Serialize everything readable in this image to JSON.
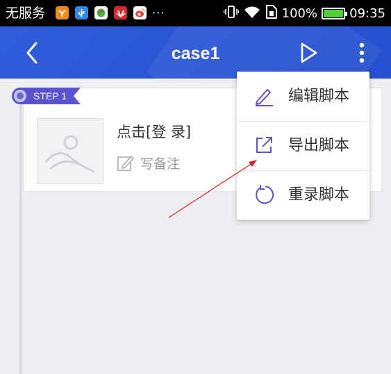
{
  "status_bar": {
    "carrier": "无服务",
    "more": "···",
    "battery_text": "100%",
    "time": "09:35",
    "battery_level": 1.0,
    "app_icons": [
      {
        "name": "game-app-icon",
        "color": "#f28a1c"
      },
      {
        "name": "usb-icon",
        "color": "#2d8ae6"
      },
      {
        "name": "browser-app-icon",
        "color": "#3fb64a"
      },
      {
        "name": "huawei-app-icon",
        "color": "#d8262e"
      },
      {
        "name": "weibo-app-icon",
        "color": "#f0a020"
      }
    ]
  },
  "app_bar": {
    "title": "case1",
    "back_icon": "chevron-left-icon",
    "play_icon": "play-icon",
    "more_icon": "more-vertical-icon",
    "color": "#2a56d6"
  },
  "step": {
    "badge": "STEP 1",
    "action": "点击[登 录]",
    "note_label": "写备注",
    "accent": "#5a52cf"
  },
  "menu": {
    "items": [
      {
        "label": "编辑脚本",
        "icon": "edit-pen-icon"
      },
      {
        "label": "导出脚本",
        "icon": "export-icon"
      },
      {
        "label": "重录脚本",
        "icon": "re-record-icon"
      }
    ],
    "icon_color": "#5a52cf"
  }
}
